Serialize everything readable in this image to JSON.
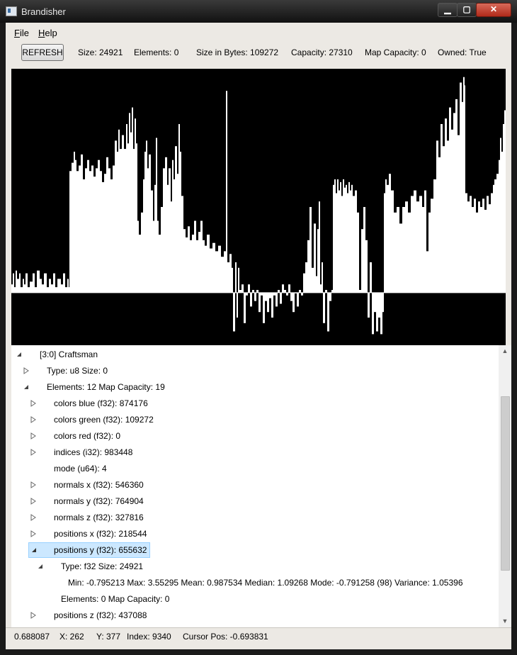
{
  "window": {
    "title": "Brandisher",
    "minimize": "▁",
    "maximize": "▢",
    "close": "✕"
  },
  "menu": {
    "file_first": "F",
    "file_rest": "ile",
    "help_first": "H",
    "help_rest": "elp"
  },
  "toolbar": {
    "refresh": "REFRESH",
    "size": "Size: 24921",
    "elements": "Elements: 0",
    "size_bytes": "Size in Bytes: 109272",
    "capacity": "Capacity: 27310",
    "map_capacity": "Map Capacity: 0",
    "owned": "Owned: True"
  },
  "chart_data": {
    "type": "area",
    "title": "",
    "xlabel": "",
    "ylabel": "",
    "series_name": "positions y (f32)",
    "baseline_fraction_from_top": 0.81,
    "colors": {
      "background": "#000000",
      "fill": "#ffffff"
    },
    "profile": [
      [
        0,
        0.78
      ],
      [
        2,
        0.74
      ],
      [
        4,
        0.79
      ],
      [
        6,
        0.73
      ],
      [
        8,
        0.76
      ],
      [
        11,
        0.74
      ],
      [
        13,
        0.79
      ],
      [
        16,
        0.76
      ],
      [
        18,
        0.78
      ],
      [
        20,
        0.74
      ],
      [
        23,
        0.79
      ],
      [
        26,
        0.77
      ],
      [
        30,
        0.74
      ],
      [
        33,
        0.79
      ],
      [
        36,
        0.73
      ],
      [
        40,
        0.76
      ],
      [
        43,
        0.78
      ],
      [
        46,
        0.74
      ],
      [
        50,
        0.79
      ],
      [
        53,
        0.76
      ],
      [
        56,
        0.78
      ],
      [
        59,
        0.74
      ],
      [
        62,
        0.79
      ],
      [
        65,
        0.76
      ],
      [
        70,
        0.78
      ],
      [
        73,
        0.74
      ],
      [
        76,
        0.79
      ],
      [
        79,
        0.76
      ],
      [
        81,
        0.79
      ],
      [
        82,
        0.37
      ],
      [
        85,
        0.34
      ],
      [
        88,
        0.3
      ],
      [
        90,
        0.33
      ],
      [
        92,
        0.37
      ],
      [
        95,
        0.35
      ],
      [
        98,
        0.31
      ],
      [
        101,
        0.4
      ],
      [
        104,
        0.36
      ],
      [
        107,
        0.33
      ],
      [
        110,
        0.37
      ],
      [
        113,
        0.35
      ],
      [
        116,
        0.39
      ],
      [
        119,
        0.36
      ],
      [
        122,
        0.33
      ],
      [
        125,
        0.37
      ],
      [
        128,
        0.41
      ],
      [
        131,
        0.38
      ],
      [
        134,
        0.32
      ],
      [
        137,
        0.36
      ],
      [
        140,
        0.4
      ],
      [
        143,
        0.35
      ],
      [
        146,
        0.26
      ],
      [
        149,
        0.3
      ],
      [
        151,
        0.22
      ],
      [
        153,
        0.29
      ],
      [
        156,
        0.24
      ],
      [
        159,
        0.29
      ],
      [
        162,
        0.2
      ],
      [
        164,
        0.27
      ],
      [
        166,
        0.16
      ],
      [
        168,
        0.23
      ],
      [
        170,
        0.14
      ],
      [
        172,
        0.29
      ],
      [
        174,
        0.18
      ],
      [
        176,
        0.27
      ],
      [
        178,
        0.55
      ],
      [
        180,
        0.6
      ],
      [
        183,
        0.52
      ],
      [
        186,
        0.4
      ],
      [
        188,
        0.3
      ],
      [
        190,
        0.26
      ],
      [
        192,
        0.36
      ],
      [
        194,
        0.31
      ],
      [
        197,
        0.44
      ],
      [
        200,
        0.55
      ],
      [
        202,
        0.42
      ],
      [
        204,
        0.25
      ],
      [
        206,
        0.55
      ],
      [
        208,
        0.6
      ],
      [
        211,
        0.5
      ],
      [
        214,
        0.36
      ],
      [
        217,
        0.32
      ],
      [
        220,
        0.42
      ],
      [
        222,
        0.36
      ],
      [
        225,
        0.48
      ],
      [
        227,
        0.33
      ],
      [
        229,
        0.4
      ],
      [
        231,
        0.28
      ],
      [
        234,
        0.38
      ],
      [
        236,
        0.2
      ],
      [
        238,
        0.3
      ],
      [
        240,
        0.46
      ],
      [
        243,
        0.58
      ],
      [
        246,
        0.61
      ],
      [
        249,
        0.57
      ],
      [
        252,
        0.62
      ],
      [
        255,
        0.6
      ],
      [
        258,
        0.55
      ],
      [
        261,
        0.62
      ],
      [
        264,
        0.59
      ],
      [
        267,
        0.55
      ],
      [
        270,
        0.62
      ],
      [
        273,
        0.64
      ],
      [
        276,
        0.6
      ],
      [
        280,
        0.65
      ],
      [
        284,
        0.63
      ],
      [
        288,
        0.66
      ],
      [
        292,
        0.64
      ],
      [
        296,
        0.68
      ],
      [
        300,
        0.66
      ],
      [
        303,
        0.08
      ],
      [
        305,
        0.7
      ],
      [
        308,
        0.67
      ],
      [
        311,
        0.72
      ],
      [
        313,
        0.95
      ],
      [
        316,
        0.7
      ],
      [
        318,
        0.9
      ],
      [
        320,
        0.72
      ],
      [
        322,
        0.8
      ],
      [
        325,
        0.78
      ],
      [
        328,
        0.92
      ],
      [
        331,
        0.82
      ],
      [
        334,
        0.78
      ],
      [
        337,
        0.86
      ],
      [
        340,
        0.8
      ],
      [
        343,
        0.84
      ],
      [
        346,
        0.8
      ],
      [
        349,
        0.88
      ],
      [
        352,
        0.82
      ],
      [
        355,
        0.92
      ],
      [
        358,
        0.84
      ],
      [
        361,
        0.88
      ],
      [
        364,
        0.83
      ],
      [
        367,
        0.9
      ],
      [
        370,
        0.82
      ],
      [
        373,
        0.86
      ],
      [
        376,
        0.8
      ],
      [
        379,
        0.85
      ],
      [
        382,
        0.78
      ],
      [
        385,
        0.8
      ],
      [
        388,
        0.82
      ],
      [
        391,
        0.78
      ],
      [
        394,
        0.84
      ],
      [
        397,
        0.88
      ],
      [
        400,
        0.81
      ],
      [
        403,
        0.86
      ],
      [
        406,
        0.8
      ],
      [
        409,
        0.82
      ],
      [
        412,
        0.74
      ],
      [
        415,
        0.7
      ],
      [
        418,
        0.62
      ],
      [
        421,
        0.5
      ],
      [
        424,
        0.72
      ],
      [
        427,
        0.56
      ],
      [
        430,
        0.75
      ],
      [
        432,
        0.58
      ],
      [
        434,
        0.48
      ],
      [
        436,
        0.78
      ],
      [
        438,
        0.7
      ],
      [
        440,
        0.92
      ],
      [
        443,
        0.8
      ],
      [
        446,
        0.95
      ],
      [
        449,
        0.84
      ],
      [
        452,
        0.8
      ],
      [
        454,
        0.42
      ],
      [
        456,
        0.4
      ],
      [
        458,
        0.45
      ],
      [
        460,
        0.4
      ],
      [
        462,
        0.44
      ],
      [
        464,
        0.41
      ],
      [
        466,
        0.46
      ],
      [
        468,
        0.4
      ],
      [
        470,
        0.43
      ],
      [
        472,
        0.42
      ],
      [
        474,
        0.45
      ],
      [
        476,
        0.41
      ],
      [
        478,
        0.44
      ],
      [
        480,
        0.42
      ],
      [
        482,
        0.46
      ],
      [
        485,
        0.44
      ],
      [
        488,
        0.52
      ],
      [
        491,
        0.8
      ],
      [
        494,
        0.58
      ],
      [
        497,
        0.5
      ],
      [
        500,
        0.62
      ],
      [
        503,
        0.9
      ],
      [
        506,
        0.7
      ],
      [
        509,
        0.96
      ],
      [
        512,
        0.88
      ],
      [
        515,
        0.95
      ],
      [
        518,
        0.9
      ],
      [
        521,
        0.96
      ],
      [
        524,
        0.88
      ],
      [
        526,
        0.45
      ],
      [
        528,
        0.4
      ],
      [
        530,
        0.42
      ],
      [
        533,
        0.38
      ],
      [
        536,
        0.44
      ],
      [
        540,
        0.52
      ],
      [
        544,
        0.5
      ],
      [
        548,
        0.56
      ],
      [
        552,
        0.5
      ],
      [
        556,
        0.48
      ],
      [
        560,
        0.52
      ],
      [
        564,
        0.46
      ],
      [
        568,
        0.44
      ],
      [
        572,
        0.48
      ],
      [
        576,
        0.46
      ],
      [
        580,
        0.5
      ],
      [
        583,
        0.44
      ],
      [
        586,
        0.66
      ],
      [
        589,
        0.52
      ],
      [
        592,
        0.47
      ],
      [
        596,
        0.4
      ],
      [
        600,
        0.26
      ],
      [
        603,
        0.32
      ],
      [
        606,
        0.2
      ],
      [
        609,
        0.28
      ],
      [
        612,
        0.18
      ],
      [
        615,
        0.26
      ],
      [
        618,
        0.14
      ],
      [
        621,
        0.22
      ],
      [
        624,
        0.16
      ],
      [
        627,
        0.11
      ],
      [
        630,
        0.24
      ],
      [
        633,
        0.05
      ],
      [
        636,
        0.12
      ],
      [
        638,
        0.03
      ],
      [
        640,
        0.06
      ],
      [
        641,
        0.45
      ],
      [
        644,
        0.48
      ],
      [
        647,
        0.46
      ],
      [
        650,
        0.5
      ],
      [
        653,
        0.47
      ],
      [
        656,
        0.52
      ],
      [
        659,
        0.48
      ],
      [
        662,
        0.5
      ],
      [
        665,
        0.47
      ],
      [
        668,
        0.51
      ],
      [
        671,
        0.46
      ],
      [
        674,
        0.49
      ],
      [
        677,
        0.45
      ],
      [
        680,
        0.42
      ],
      [
        682,
        0.4
      ],
      [
        685,
        0.38
      ],
      [
        688,
        0.33
      ],
      [
        690,
        0.25
      ],
      [
        692,
        0.3
      ],
      [
        694,
        0.2
      ],
      [
        696,
        0.15
      ],
      [
        698,
        0.12
      ]
    ]
  },
  "tree": {
    "root": "[3:0] Craftsman",
    "type": "Type: u8 Size: 0",
    "elements": "Elements: 12  Map Capacity: 19",
    "items": [
      "colors blue (f32):   874176",
      "colors green (f32):   109272",
      "colors red (f32):   0",
      "indices (i32):   983448",
      "mode (u64):   4",
      "normals x (f32):   546360",
      "normals y (f32):   764904",
      "normals z (f32):   327816",
      "positions x (f32):   218544",
      "positions y (f32):   655632"
    ],
    "sub_type": "Type: f32 Size: 24921",
    "stats": "Min: -0.795213   Max: 3.55295   Mean: 0.987534   Median: 1.09268   Mode: -0.791258 (98)   Variance: 1.05396",
    "sub_elements": "Elements: 0  Map Capacity: 0",
    "last": "positions z (f32):   437088"
  },
  "status": {
    "value": "0.688087",
    "x": "X: 262",
    "y": "Y: 377",
    "index": "Index: 9340",
    "cursor": "Cursor Pos: -0.693831"
  }
}
